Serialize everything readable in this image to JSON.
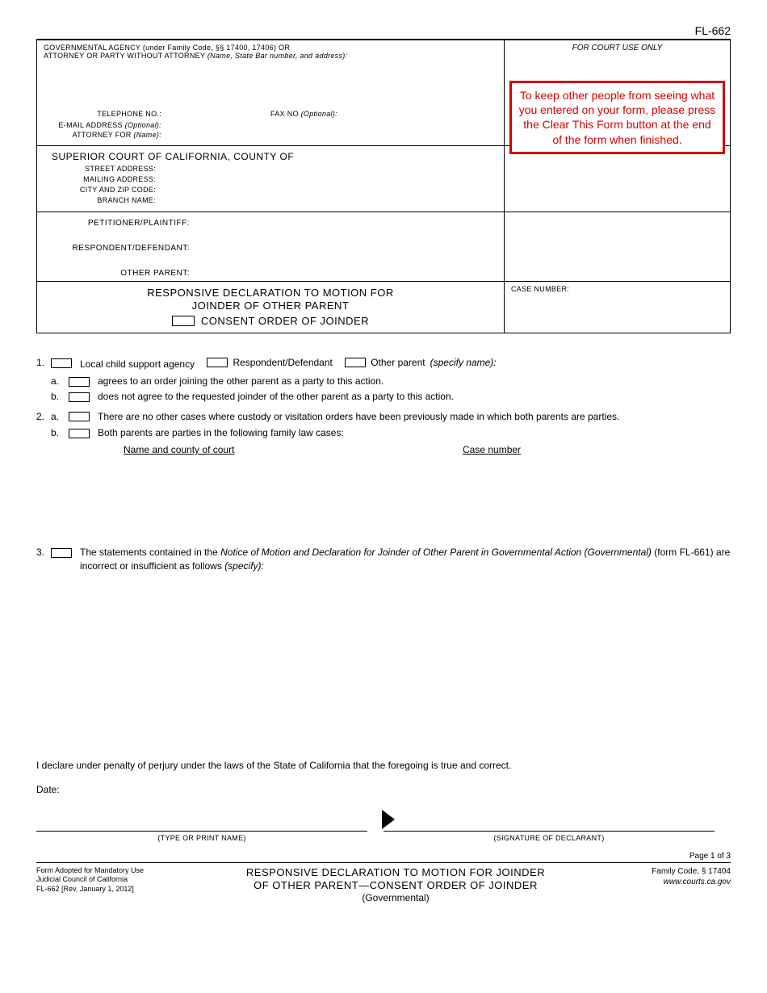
{
  "form_number": "FL-662",
  "header": {
    "agency_line1": "GOVERNMENTAL AGENCY (under Family Code, §§ 17400, 17406) OR",
    "agency_line2": "ATTORNEY OR PARTY WITHOUT ATTORNEY ",
    "agency_line2_italic": "(Name, State Bar number, and address):",
    "court_use": "FOR COURT USE ONLY",
    "telephone": "TELEPHONE NO.:",
    "fax": "FAX NO. ",
    "optional": "(Optional):",
    "email": "E-MAIL ADDRESS ",
    "attorney_for": "ATTORNEY FOR ",
    "name_italic": "(Name):"
  },
  "warning": "To keep other people from seeing what you entered on your form, please press the Clear This Form button at the end of the form when finished.",
  "court": {
    "title": "SUPERIOR COURT OF CALIFORNIA, COUNTY OF",
    "street": "STREET ADDRESS:",
    "mailing": "MAILING ADDRESS:",
    "cityzip": "CITY AND ZIP CODE:",
    "branch": "BRANCH NAME:"
  },
  "parties": {
    "petitioner": "PETITIONER/PLAINTIFF:",
    "respondent": "RESPONDENT/DEFENDANT:",
    "other": "OTHER PARENT:"
  },
  "title_block": {
    "line1": "RESPONSIVE DECLARATION TO MOTION FOR",
    "line2": "JOINDER OF OTHER PARENT",
    "consent": "CONSENT ORDER OF JOINDER",
    "case_number": "CASE NUMBER:"
  },
  "body": {
    "item1": {
      "num": "1.",
      "opts": {
        "lcsa": "Local child support agency",
        "resp": "Respondent/Defendant",
        "other": "Other parent ",
        "specify": "(specify name):"
      },
      "a": {
        "let": "a.",
        "text": "agrees to an order joining the other parent as a party to this action."
      },
      "b": {
        "let": "b.",
        "text": "does not agree to the requested joinder of the other parent as a party to this action."
      }
    },
    "item2": {
      "num": "2.",
      "a": {
        "let": "a.",
        "text": "There are no other cases where custody or visitation orders have been previously made in which both parents are parties."
      },
      "b": {
        "let": "b.",
        "text": "Both parents are parties in the following family law cases:"
      },
      "col1": "Name and county of court",
      "col2": "Case number"
    },
    "item3": {
      "num": "3.",
      "pre": "The statements contained in the ",
      "ital": "Notice of Motion and Declaration for Joinder of Other Parent in Governmental Action (Governmental)",
      "post1": " (form FL-661) are incorrect or insufficient as follows ",
      "post2": "(specify):"
    },
    "perjury": "I declare under penalty of perjury under the laws of the State of California that the foregoing is true and correct.",
    "date": "Date:",
    "sig_name": "(TYPE OR PRINT NAME)",
    "sig_decl": "(SIGNATURE OF DECLARANT)"
  },
  "page": "Page 1 of 3",
  "footer": {
    "left1": "Form Adopted for Mandatory Use",
    "left2": "Judicial Council of California",
    "left3": "FL-662 [Rev. January 1, 2012]",
    "center1": "RESPONSIVE DECLARATION TO MOTION FOR JOINDER",
    "center2": "OF OTHER PARENT—CONSENT ORDER OF JOINDER",
    "center3": "(Governmental)",
    "right1": "Family Code, § 17404",
    "right2": "www.courts.ca.gov"
  }
}
